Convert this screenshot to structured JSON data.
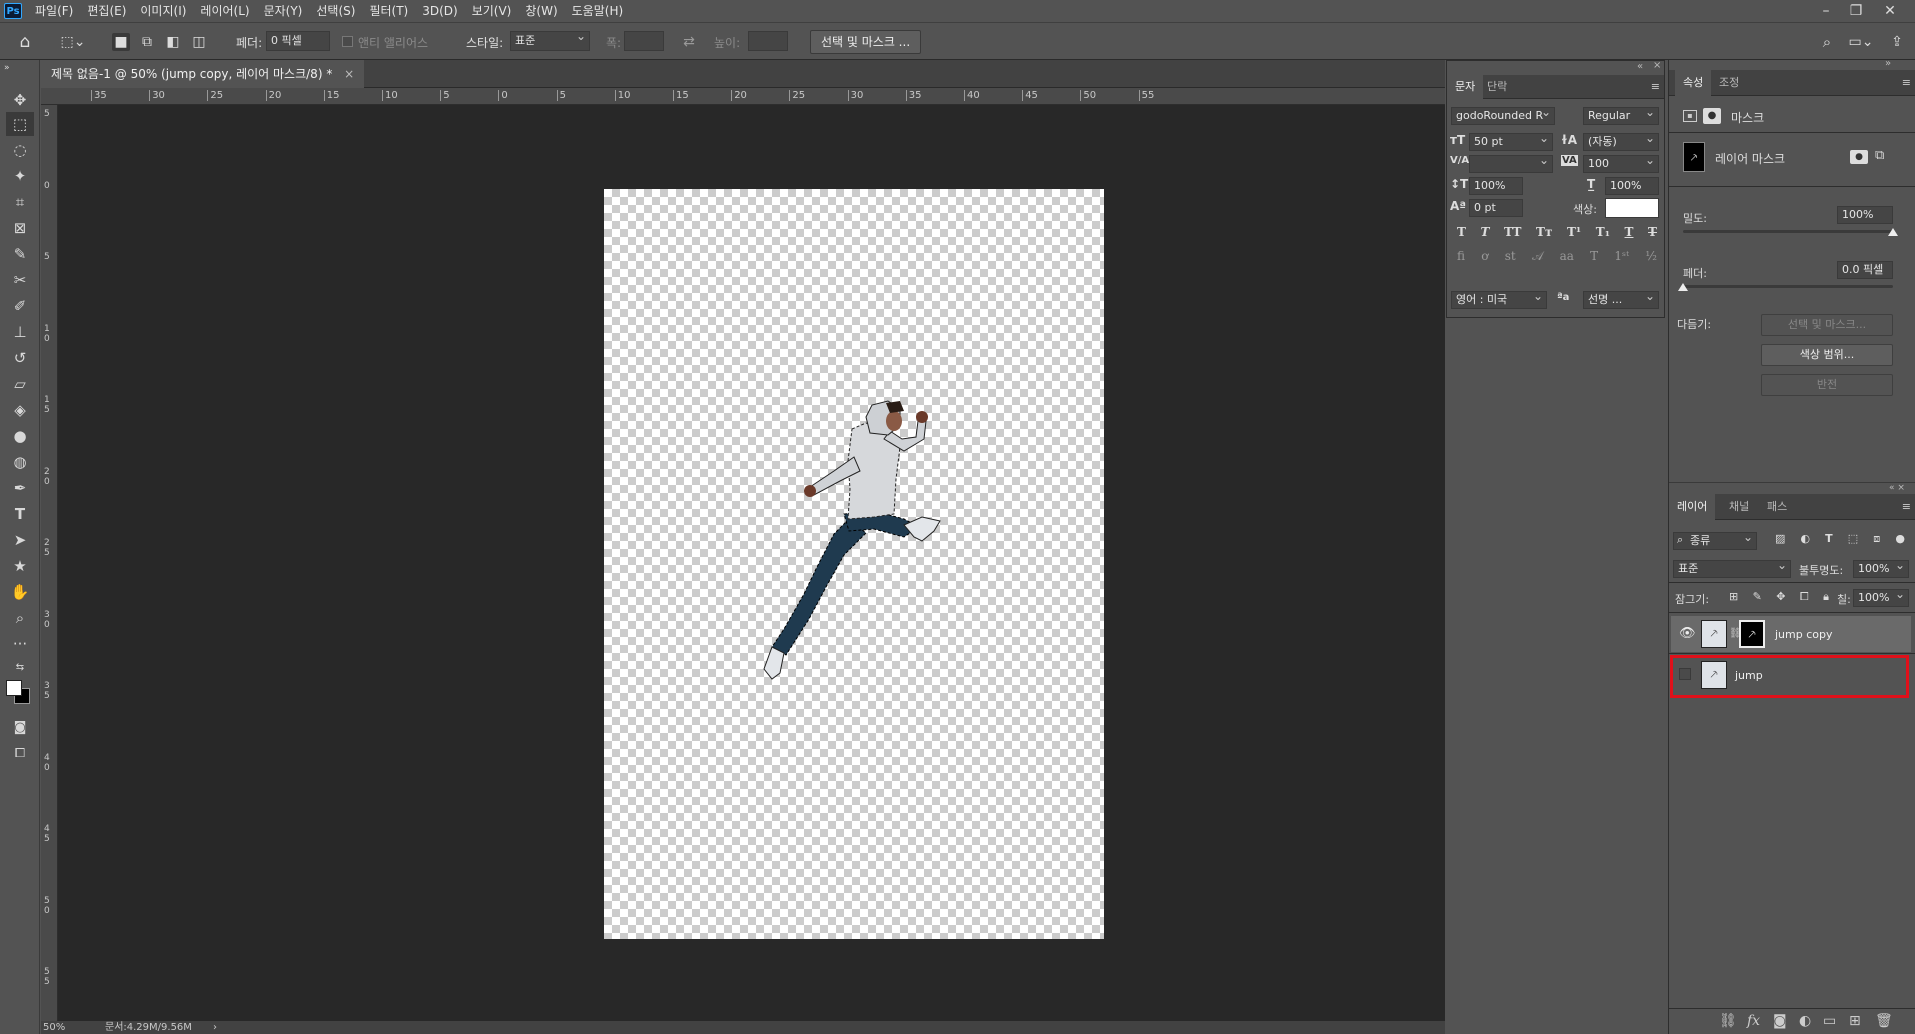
{
  "app": {
    "logo": "Ps"
  },
  "menu": [
    "파일(F)",
    "편집(E)",
    "이미지(I)",
    "레이어(L)",
    "문자(Y)",
    "선택(S)",
    "필터(T)",
    "3D(D)",
    "보기(V)",
    "창(W)",
    "도움말(H)"
  ],
  "window_controls": {
    "minimize": "–",
    "restore": "❐",
    "close": "✕"
  },
  "options": {
    "feather_label": "페더:",
    "feather_value": "0 픽셀",
    "antialias_label": "앤티 앨리어스",
    "style_label": "스타일:",
    "style_value": "표준",
    "width_label": "폭:",
    "height_label": "높이:",
    "select_mask_button": "선택 및 마스크 ..."
  },
  "document": {
    "tab_title": "제목 없음-1 @ 50% (jump copy, 레이어 마스크/8) *",
    "zoom": "50%",
    "doc_size": "문서:4.29M/9.56M"
  },
  "rulers": {
    "horizontal": [
      "35",
      "30",
      "25",
      "20",
      "15",
      "10",
      "5",
      "0",
      "5",
      "10",
      "15",
      "20",
      "25",
      "30",
      "35",
      "40",
      "45",
      "50",
      "55"
    ],
    "vertical": [
      "5",
      "0",
      "5",
      "10",
      "15",
      "20",
      "25",
      "30",
      "35",
      "40",
      "45",
      "50",
      "55"
    ]
  },
  "character_panel": {
    "tabs": [
      "문자",
      "단락"
    ],
    "font_family": "godoRounded R",
    "font_style": "Regular",
    "font_size": "50 pt",
    "leading": "(자동)",
    "kerning": "",
    "tracking": "100",
    "vertical_scale": "100%",
    "horizontal_scale": "100%",
    "baseline_shift": "0 pt",
    "color_label": "색상:",
    "color_value": "#ffffff",
    "language": "영어 : 미국",
    "antialias": "선명 ..."
  },
  "properties": {
    "tabs": [
      "속성",
      "조정"
    ],
    "section_title": "마스크",
    "mask_label": "레이어 마스크",
    "density_label": "밀도:",
    "density_value": "100%",
    "density_fraction": 1.0,
    "feather_label": "페더:",
    "feather_value": "0.0 픽셀",
    "feather_fraction": 0.0,
    "refine_label": "다듬기:",
    "select_mask_button": "선택 및 마스크...",
    "color_range_button": "색상 범위...",
    "invert_button": "반전"
  },
  "layers_panel": {
    "tabs": [
      "레이어",
      "채널",
      "패스"
    ],
    "filter_label": "종류",
    "blend_mode": "표준",
    "opacity_label": "불투명도:",
    "opacity_value": "100%",
    "lock_label": "잠그기:",
    "fill_label": "칠:",
    "fill_value": "100%",
    "layers": [
      {
        "name": "jump copy",
        "visible": true,
        "selected": true,
        "has_mask": true
      },
      {
        "name": "jump",
        "visible": false,
        "selected": false,
        "has_mask": false,
        "highlighted": true
      }
    ]
  },
  "colors": {
    "highlight_box": "#e0101a",
    "selected_layer_bg": "#6a6a6a"
  }
}
